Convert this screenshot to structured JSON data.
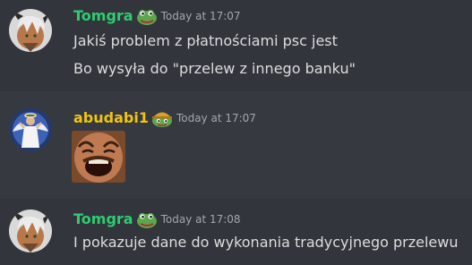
{
  "messages": [
    {
      "username": "Tomgra",
      "username_color": "#2ecc71",
      "timestamp": "Today at 17:07",
      "lines": [
        "Jakiś problem z płatnościami psc jest",
        "Bo wysyła do \"przelew z innego banku\""
      ]
    },
    {
      "username": "abudabi1",
      "username_color": "#f1c40f",
      "timestamp": "Today at 17:07"
    },
    {
      "username": "Tomgra",
      "username_color": "#2ecc71",
      "timestamp": "Today at 17:08",
      "lines": [
        "I pokazuje dane do wykonania tradycyjnego przelewu"
      ]
    }
  ],
  "icons": {
    "avatar_1": "anime-character-avatar-icon",
    "badge_1": "pepe-frog-badge-icon",
    "avatar_2": "angel-figure-avatar-icon",
    "badge_2": "pepe-frog-helmet-badge-icon",
    "emote": "laughing-man-emote-icon",
    "avatar_3": "anime-character-avatar-icon",
    "badge_3": "pepe-frog-badge-icon"
  },
  "colors": {
    "background": "#36393f",
    "highlight_background": "#32353b",
    "message_text": "#dcddde",
    "timestamp_text": "#a3a6aa"
  }
}
